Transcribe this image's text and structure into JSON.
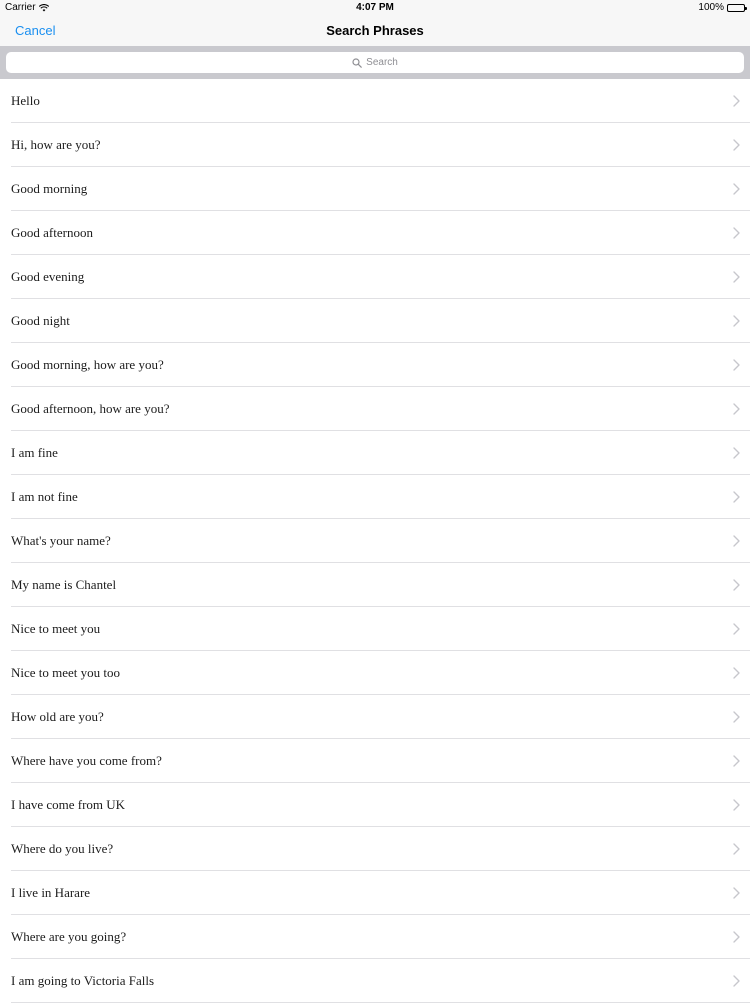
{
  "status_bar": {
    "carrier": "Carrier",
    "time": "4:07 PM",
    "battery": "100%"
  },
  "nav": {
    "cancel_label": "Cancel",
    "title": "Search Phrases"
  },
  "search": {
    "placeholder": "Search"
  },
  "icons": {
    "wifi": "wifi-icon",
    "battery": "battery-icon",
    "search": "magnifier-icon",
    "disclosure": "chevron-right-icon"
  },
  "colors": {
    "accent": "#1a8ff0",
    "search_bar_bg": "#c9c9ce",
    "separator": "#e0e0e3",
    "chevron": "#c7c7cc"
  },
  "phrases": [
    "Hello",
    "Hi, how are you?",
    "Good morning",
    "Good afternoon",
    "Good evening",
    "Good night",
    "Good morning, how are you?",
    "Good afternoon, how are you?",
    "I am fine",
    "I am not fine",
    "What's your name?",
    "My name is Chantel",
    "Nice to meet you",
    "Nice to meet you too",
    "How old are you?",
    "Where have you come from?",
    "I have come from UK",
    "Where do you live?",
    "I live in Harare",
    "Where are you going?",
    "I am going to Victoria Falls"
  ]
}
